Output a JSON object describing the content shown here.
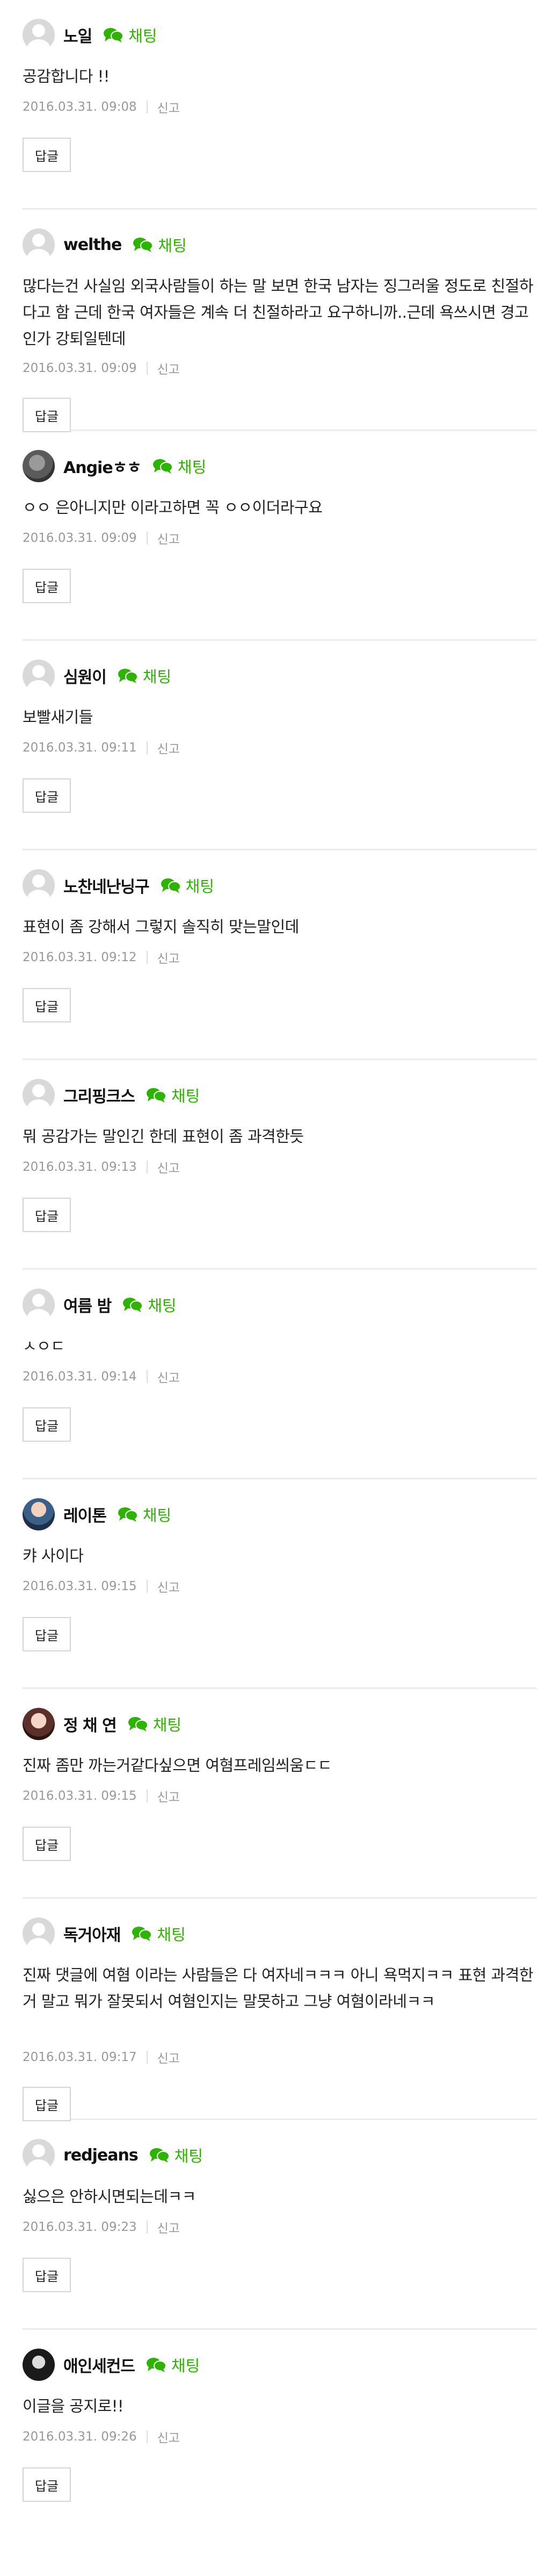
{
  "labels": {
    "chat": "채팅",
    "report": "신고",
    "reply": "답글"
  },
  "colors": {
    "chat_green": "#2db400",
    "meta_gray": "#999999",
    "divider": "#ececec"
  },
  "comments": [
    {
      "nickname": "노일",
      "avatar": "default",
      "text": "공감합니다 !!",
      "date": "2016.03.31. 09:08"
    },
    {
      "nickname": "welthe",
      "avatar": "default",
      "text": "많다는건 사실임 외국사람들이 하는 말 보면 한국 남자는 징그러울 정도로 친절하다고 함 근데 한국 여자들은 계속 더 친절하라고 요구하니까..근데 욕쓰시면 경고인가 강퇴일텐데",
      "date": "2016.03.31. 09:09"
    },
    {
      "nickname": "Angieㅎㅎ",
      "avatar": "photo",
      "text": "ㅇㅇ 은아니지만 이라고하면 꼭 ㅇㅇ이더라구요",
      "date": "2016.03.31. 09:09"
    },
    {
      "nickname": "심원이",
      "avatar": "default",
      "text": "보빨새기들",
      "date": "2016.03.31. 09:11"
    },
    {
      "nickname": "노찬네난닝구",
      "avatar": "default",
      "text": "표현이 좀 강해서 그렇지 솔직히 맞는말인데",
      "date": "2016.03.31. 09:12"
    },
    {
      "nickname": "그리핑크스",
      "avatar": "default",
      "text": "뭐 공감가는 말인긴 한데 표현이 좀 과격한듯",
      "date": "2016.03.31. 09:13"
    },
    {
      "nickname": "여름 밤",
      "avatar": "default",
      "text": "ㅅㅇㄷ",
      "date": "2016.03.31. 09:14"
    },
    {
      "nickname": "레이톤",
      "avatar": "photo",
      "text": "캬 사이다",
      "date": "2016.03.31. 09:15"
    },
    {
      "nickname": "정 채 연",
      "avatar": "photo",
      "text": "진짜 좀만 까는거같다싶으면 여혐프레임씌움ㄷㄷ",
      "date": "2016.03.31. 09:15"
    },
    {
      "nickname": "독거아재",
      "avatar": "default",
      "text": "진짜 댓글에 여혐 이라는 사람들은 다 여자네ㅋㅋㅋ 아니 욕먹지ㅋㅋ 표현 과격한거 말고 뭐가 잘못되서 여혐인지는 말못하고 그냥 여혐이라네ㅋㅋ",
      "date": "2016.03.31. 09:17"
    },
    {
      "nickname": "redjeans",
      "avatar": "default",
      "text": "싫으은 안하시면되는데ㅋㅋ",
      "date": "2016.03.31. 09:23"
    },
    {
      "nickname": "애인세컨드",
      "avatar": "photo",
      "text": "이글을 공지로!!",
      "date": "2016.03.31. 09:26"
    }
  ]
}
